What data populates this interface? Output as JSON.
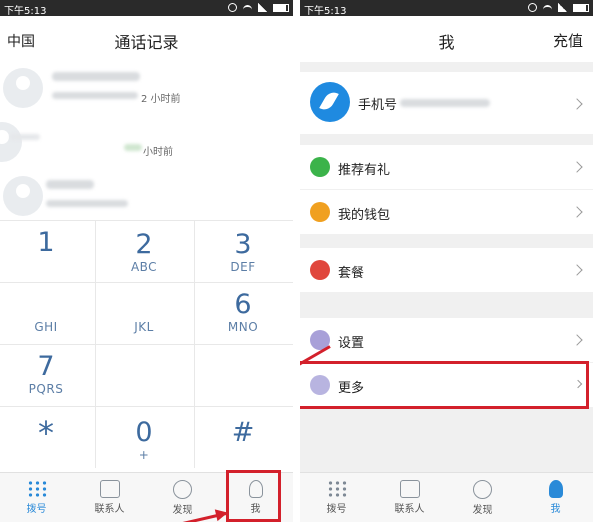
{
  "left_screen": {
    "status_time": "下午5:13",
    "header": {
      "left": "中国",
      "title": "通话记录"
    },
    "calls": [
      {
        "time": "2 小时前"
      },
      {
        "time": "小时前"
      },
      {
        "time": ""
      }
    ],
    "keys": [
      {
        "digit": "1",
        "letters": ""
      },
      {
        "digit": "2",
        "letters": "ABC"
      },
      {
        "digit": "3",
        "letters": "DEF"
      },
      {
        "digit": "",
        "letters": "GHI"
      },
      {
        "digit": "",
        "letters": "JKL"
      },
      {
        "digit": "6",
        "letters": "MNO"
      },
      {
        "digit": "7",
        "letters": "PQRS"
      },
      {
        "digit": "*",
        "letters": ""
      },
      {
        "digit": "0",
        "letters": "+"
      },
      {
        "digit": "#",
        "letters": ""
      }
    ],
    "tabs": [
      "拨号",
      "联系人",
      "发现",
      "我"
    ],
    "active_tab": "拨号"
  },
  "right_screen": {
    "status_time": "下午5:13",
    "header": {
      "title": "我",
      "right": "充值"
    },
    "profile": {
      "label": "手机号"
    },
    "menu": [
      {
        "label": "推荐有礼",
        "icon": "gift-icon",
        "color": "#3bb34a"
      },
      {
        "label": "我的钱包",
        "icon": "wallet-icon",
        "color": "#f0a020"
      },
      {
        "label": "套餐",
        "icon": "package-icon",
        "color": "#e0463c"
      },
      {
        "label": "设置",
        "icon": "gear-icon",
        "color": "#a8a0d8"
      },
      {
        "label": "更多",
        "icon": "more-icon",
        "color": "#b8b4e0"
      }
    ],
    "tabs": [
      "拨号",
      "联系人",
      "发现",
      "我"
    ],
    "active_tab": "我"
  },
  "colors": {
    "accent": "#2a8ad8",
    "highlight": "#d3202b"
  }
}
